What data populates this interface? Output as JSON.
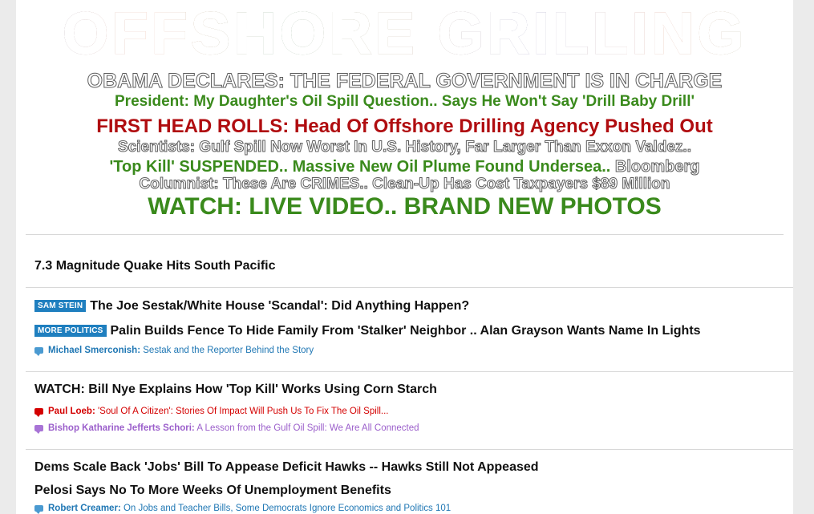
{
  "splash": {
    "mega_headline": "OFFSHORE GRILLING",
    "line1": "OBAMA DECLARES: THE FEDERAL GOVERNMENT IS IN CHARGE",
    "line2": "President: My Daughter's Oil Spill Question.. Says He Won't Say 'Drill Baby Drill'",
    "line3": "FIRST HEAD ROLLS: Head Of Offshore Drilling Agency Pushed Out",
    "line4": "Scientists: Gulf Spill Now Worst In U.S. History, Far Larger Than Exxon Valdez..",
    "line5_green": "'Top Kill' SUSPENDED.. Massive New Oil Plume Found Undersea..",
    "line5_outline": "Bloomberg",
    "line6": "Columnist: These Are CRIMES.. Clean-Up Has Cost Taxpayers $89 Million",
    "line7": "WATCH: LIVE VIDEO.. BRAND NEW PHOTOS"
  },
  "stories": {
    "quake": "7.3 Magnitude Quake Hits South Pacific",
    "sestak_badge": "SAM STEIN",
    "sestak": "The Joe Sestak/White House 'Scandal': Did Anything Happen?",
    "palin_badge": "MORE POLITICS",
    "palin": "Palin Builds Fence To Hide Family From 'Stalker' Neighbor .. Alan Grayson Wants Name In Lights",
    "smerconish_author": "Michael Smerconish:",
    "smerconish_title": "Sestak and the Reporter Behind the Story",
    "nye": "WATCH: Bill Nye Explains How 'Top Kill' Works Using Corn Starch",
    "loeb_author": "Paul Loeb:",
    "loeb_title": "'Soul Of A Citizen': Stories Of Impact Will Push Us To Fix The Oil Spill...",
    "schori_author": "Bishop Katharine Jefferts Schori:",
    "schori_title": "A Lesson from the Gulf Oil Spill: We Are All Connected",
    "dems": "Dems Scale Back 'Jobs' Bill To Appease Deficit Hawks -- Hawks Still Not Appeased",
    "pelosi": "Pelosi Says No To More Weeks Of Unemployment Benefits",
    "creamer_author": "Robert Creamer:",
    "creamer_title": "On Jobs and Teacher Bills, Some Democrats Ignore Economics and Politics 101"
  },
  "colors": {
    "green": "#3a8a1c",
    "red": "#b00d10",
    "badge_blue": "#1f7fbf",
    "blog_blue": "#1f77b4",
    "blog_red": "#d40000",
    "blog_purple": "#9b5fcb"
  }
}
